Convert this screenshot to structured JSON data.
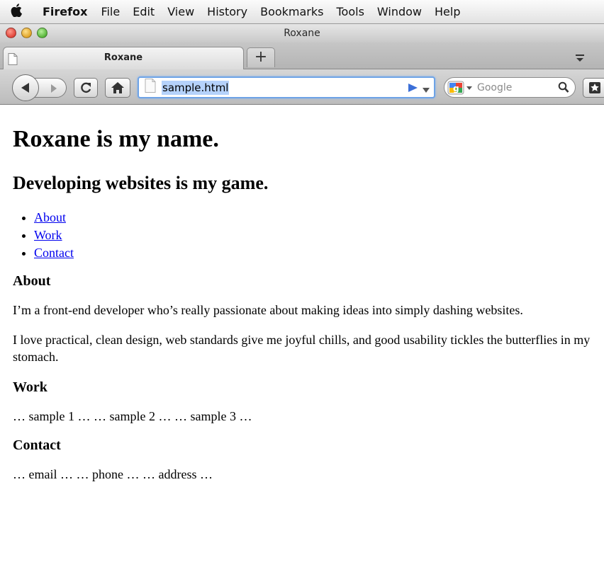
{
  "menubar": {
    "app_name": "Firefox",
    "items": [
      "File",
      "Edit",
      "View",
      "History",
      "Bookmarks",
      "Tools",
      "Window",
      "Help"
    ]
  },
  "window": {
    "title": "Roxane"
  },
  "tabs": [
    {
      "label": "Roxane",
      "active": true
    }
  ],
  "new_tab_label": "+",
  "toolbar": {
    "url": "sample.html",
    "search_placeholder": "Google"
  },
  "page": {
    "h1": "Roxane is my name.",
    "h2": "Developing websites is my game.",
    "nav": [
      "About",
      "Work",
      "Contact"
    ],
    "sections": [
      {
        "heading": "About",
        "paragraphs": [
          "I’m a front-end developer who’s really passionate about making ideas into simply dashing websites.",
          "I love practical, clean design, web standards give me joyful chills, and good usability tickles the butterflies in my stomach."
        ]
      },
      {
        "heading": "Work",
        "paragraphs": [
          "… sample 1 … … sample 2 … … sample 3 …"
        ]
      },
      {
        "heading": "Contact",
        "paragraphs": [
          "… email … … phone … … address …"
        ]
      }
    ]
  },
  "colors": {
    "link": "#0000ee",
    "url_focus_border": "#6ea3e6",
    "url_selection": "#b5d2fb"
  }
}
